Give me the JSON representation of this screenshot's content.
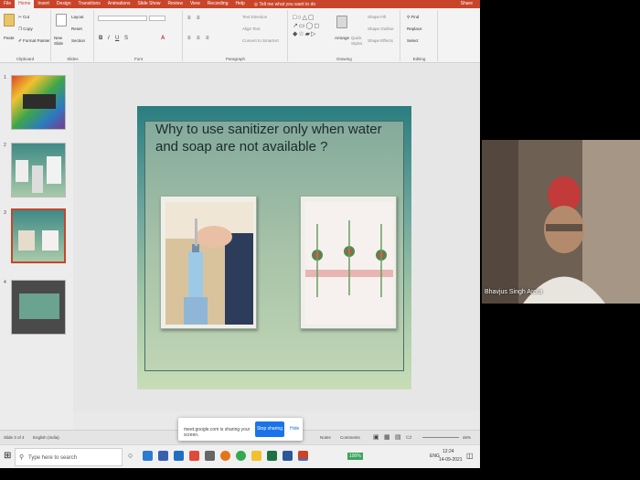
{
  "menubar": {
    "tabs": [
      "File",
      "Home",
      "Insert",
      "Design",
      "Transitions",
      "Animations",
      "Slide Show",
      "Review",
      "View",
      "Recording",
      "Help"
    ],
    "active_tab": "Home",
    "tell_me": "Tell me what you want to do",
    "user": "Share"
  },
  "ribbon": {
    "clipboard": {
      "label": "Clipboard",
      "paste": "Paste",
      "cut": "Cut",
      "copy": "Copy",
      "format_painter": "Format Painter"
    },
    "slides": {
      "label": "Slides",
      "new_slide": "New Slide",
      "layout": "Layout",
      "reset": "Reset",
      "section": "Section"
    },
    "font": {
      "label": "Font"
    },
    "paragraph": {
      "label": "Paragraph",
      "text_direction": "Text Direction",
      "align_text": "Align Text",
      "convert_smartart": "Convert to SmartArt"
    },
    "drawing": {
      "label": "Drawing",
      "arrange": "Arrange",
      "quick_styles": "Quick Styles",
      "shape_fill": "Shape Fill",
      "shape_outline": "Shape Outline",
      "shape_effects": "Shape Effects"
    },
    "editing": {
      "label": "Editing",
      "find": "Find",
      "replace": "Replace",
      "select": "Select"
    }
  },
  "thumbnails": [
    {
      "num": "1"
    },
    {
      "num": "2"
    },
    {
      "num": "3",
      "selected": true
    },
    {
      "num": "4"
    }
  ],
  "slide": {
    "title": "Why to use sanitizer only when water and soap are not available ?"
  },
  "status": {
    "slide_count": "Slide 3 of 4",
    "language": "English (India)",
    "notes": "Notes",
    "comments": "Comments",
    "zoom": "46%"
  },
  "share_banner": {
    "message": "meet.google.com is sharing your screen.",
    "stop": "Stop sharing",
    "hide": "Hide"
  },
  "taskbar": {
    "search_placeholder": "Type here to search",
    "battery": "100%",
    "lang": "ENG",
    "time": "12:24",
    "date": "14-09-2021"
  },
  "video": {
    "participant": "Bhavjus Singh Arora"
  },
  "colors": {
    "accent": "#c8452a",
    "share_button": "#1a73e8"
  }
}
